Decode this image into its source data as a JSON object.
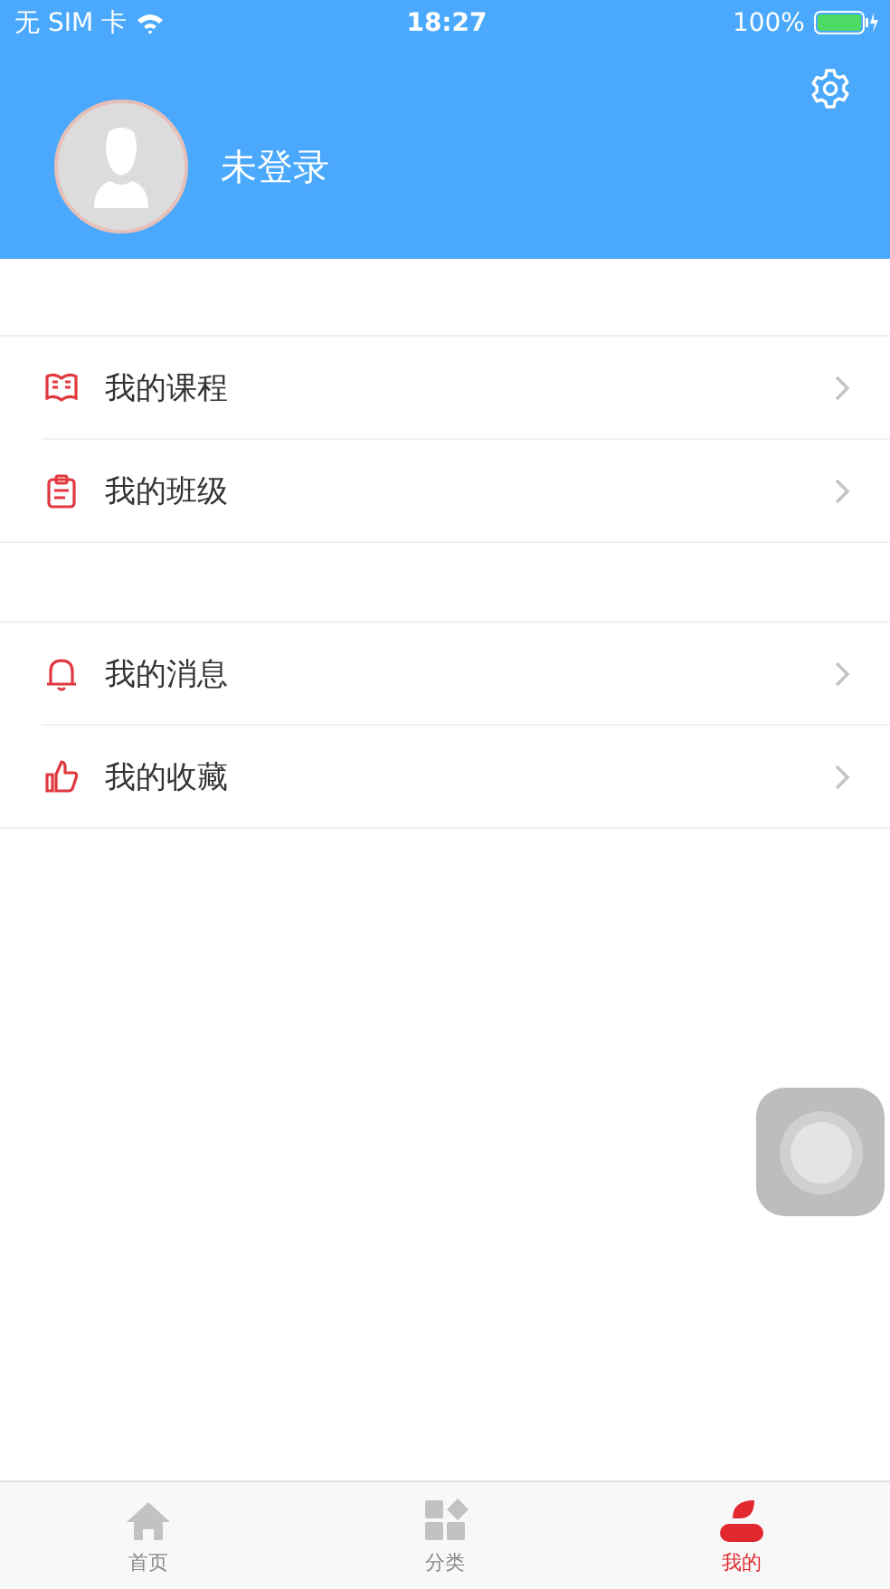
{
  "status_bar": {
    "carrier": "无 SIM 卡",
    "time": "18:27",
    "battery": "100%"
  },
  "profile": {
    "name": "未登录"
  },
  "menu_groups": [
    {
      "items": [
        {
          "kind": "course",
          "label": "我的课程"
        },
        {
          "kind": "class",
          "label": "我的班级"
        }
      ]
    },
    {
      "items": [
        {
          "kind": "message",
          "label": "我的消息"
        },
        {
          "kind": "favorite",
          "label": "我的收藏"
        }
      ]
    }
  ],
  "tabs": [
    {
      "kind": "home",
      "label": "首页",
      "selected": false
    },
    {
      "kind": "category",
      "label": "分类",
      "selected": false
    },
    {
      "kind": "mine",
      "label": "我的",
      "selected": true
    }
  ]
}
